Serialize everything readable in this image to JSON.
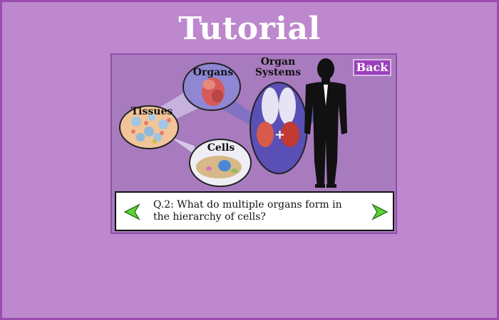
{
  "title": "Tutorial",
  "back_label": "Back",
  "diagram": {
    "organs_label": "Organs",
    "organ_systems_label": "Organ\nSystems",
    "tissues_label": "Tissues",
    "cells_label": "Cells"
  },
  "question": "Q.2: What do multiple organs form in the hierarchy of cells?",
  "colors": {
    "background": "#bd88cd",
    "panel": "#a87bbe",
    "button": "#9b3fbb",
    "arrow": "#5fd13a"
  },
  "icons": {
    "prev": "green-left-arrow-icon",
    "next": "green-right-arrow-icon"
  }
}
